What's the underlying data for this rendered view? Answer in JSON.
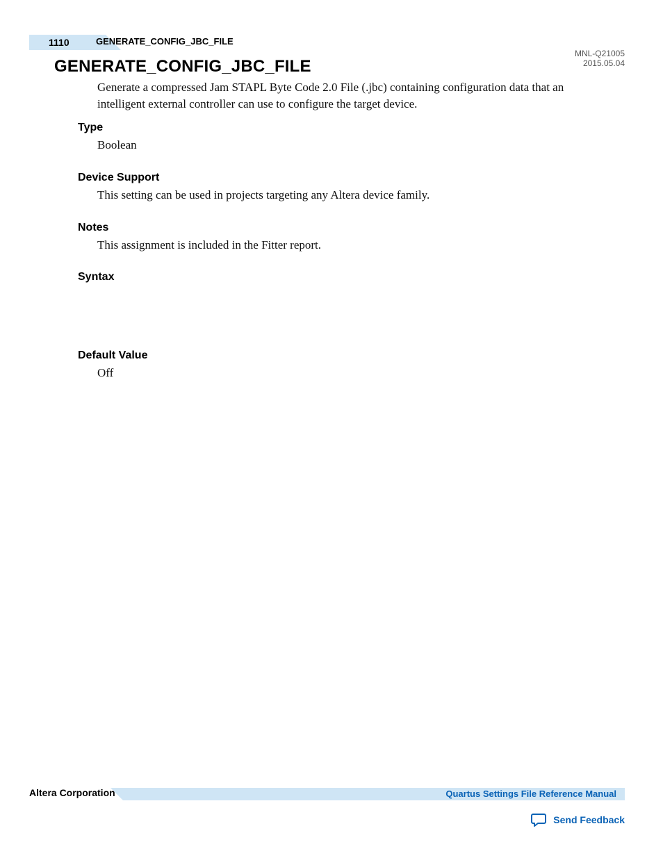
{
  "header": {
    "page_number": "1110",
    "breadcrumb": "GENERATE_CONFIG_JBC_FILE",
    "doc_code": "MNL-Q21005",
    "doc_date": "2015.05.04"
  },
  "title": "GENERATE_CONFIG_JBC_FILE",
  "intro": "Generate a compressed Jam STAPL Byte Code 2.0 File (.jbc) containing configuration data that an intelligent external controller can use to configure the target device.",
  "sections": {
    "type": {
      "heading": "Type",
      "body": "Boolean"
    },
    "device_support": {
      "heading": "Device Support",
      "body": "This setting can be used in projects targeting any Altera device family."
    },
    "notes": {
      "heading": "Notes",
      "body": "This assignment is included in the Fitter report."
    },
    "syntax": {
      "heading": "Syntax",
      "body": ""
    },
    "default_value": {
      "heading": "Default Value",
      "body": "Off"
    }
  },
  "footer": {
    "company": "Altera Corporation",
    "manual_link": "Quartus Settings File Reference Manual",
    "feedback_label": "Send Feedback"
  }
}
